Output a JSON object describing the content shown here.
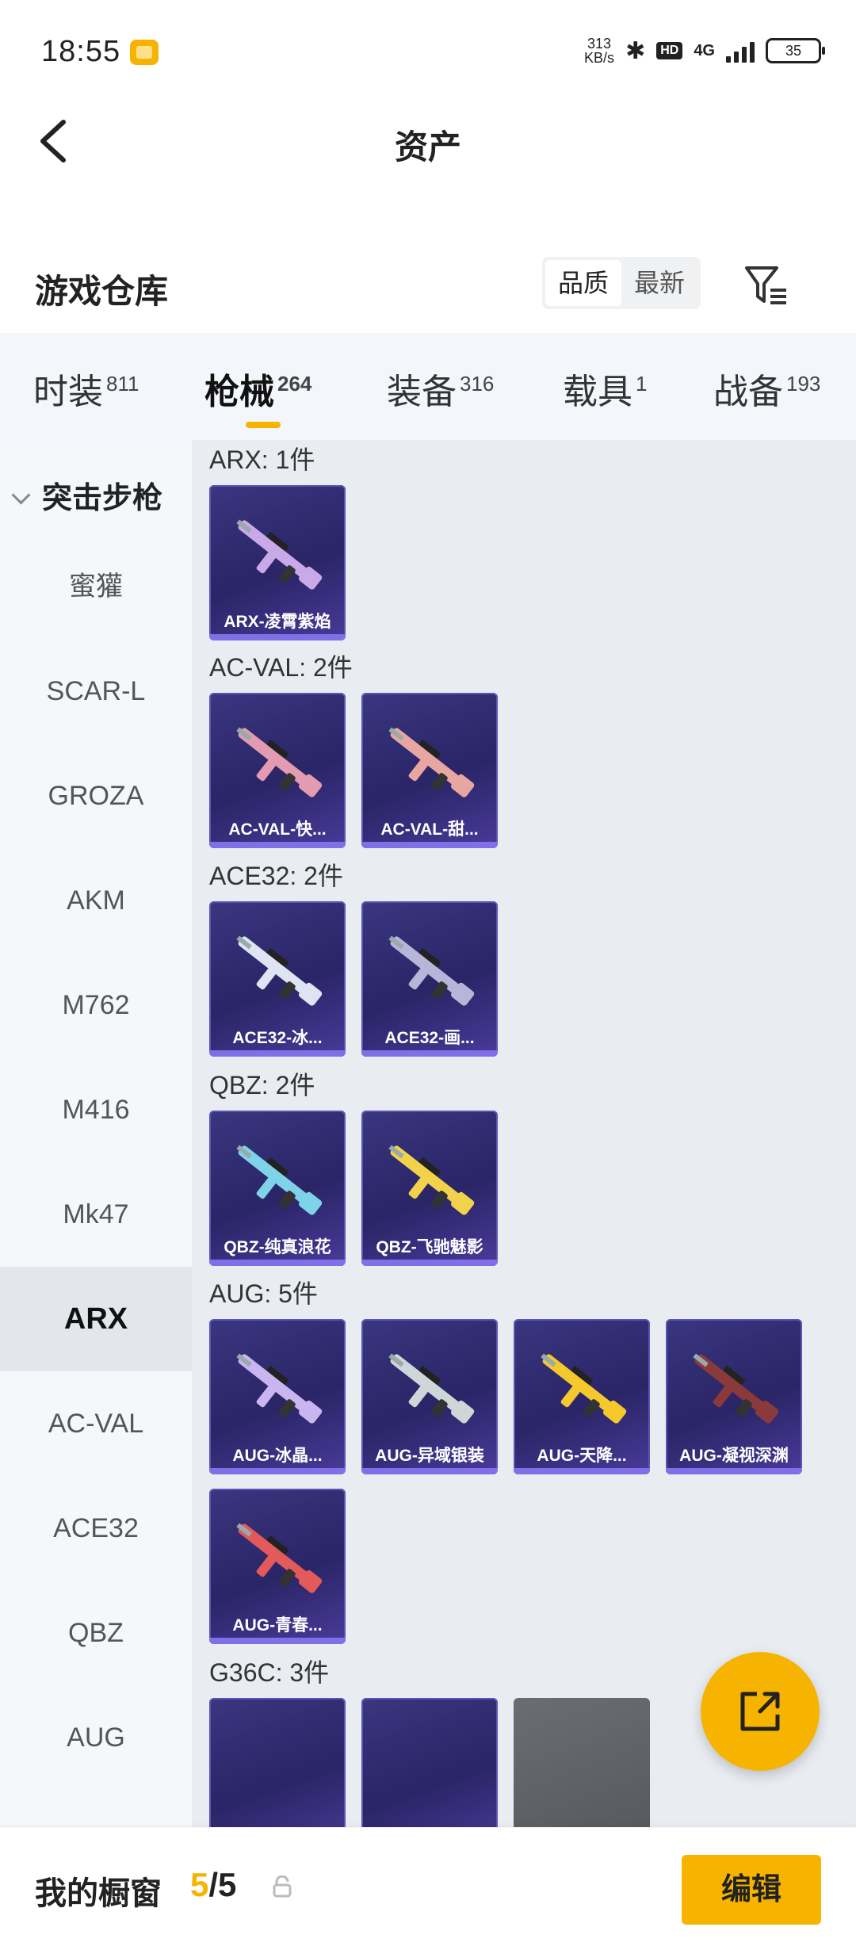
{
  "status_bar": {
    "time": "18:55",
    "net_speed_value": "313",
    "net_speed_unit": "KB/s",
    "network": "4G",
    "hd": "HD",
    "battery": "35"
  },
  "nav": {
    "title": "资产"
  },
  "warehouse": {
    "title": "游戏仓库",
    "sort_options": [
      "品质",
      "最新"
    ],
    "active_sort": "品质"
  },
  "tabs": [
    {
      "label": "时装",
      "count": "811"
    },
    {
      "label": "枪械",
      "count": "264"
    },
    {
      "label": "装备",
      "count": "316"
    },
    {
      "label": "载具",
      "count": "1"
    },
    {
      "label": "战备",
      "count": "193"
    }
  ],
  "active_tab": "枪械",
  "sidebar": {
    "header": "突击步枪",
    "items": [
      "蜜獾",
      "SCAR-L",
      "GROZA",
      "AKM",
      "M762",
      "M416",
      "Mk47",
      "ARX",
      "AC-VAL",
      "ACE32",
      "QBZ",
      "AUG"
    ],
    "active_item": "ARX"
  },
  "groups": [
    {
      "title": "ARX: 1件",
      "items": [
        {
          "name": "ARX-凌霄紫焰",
          "gun_color": "#c9a9e8"
        }
      ]
    },
    {
      "title": "AC-VAL: 2件",
      "items": [
        {
          "name": "AC-VAL-快...",
          "gun_color": "#e29bb0"
        },
        {
          "name": "AC-VAL-甜...",
          "gun_color": "#e8a6a0"
        }
      ]
    },
    {
      "title": "ACE32: 2件",
      "items": [
        {
          "name": "ACE32-冰...",
          "gun_color": "#dfe4f2"
        },
        {
          "name": "ACE32-画...",
          "gun_color": "#b8b6d8"
        }
      ]
    },
    {
      "title": "QBZ: 2件",
      "items": [
        {
          "name": "QBZ-纯真浪花",
          "gun_color": "#7fd3e8"
        },
        {
          "name": "QBZ-飞驰魅影",
          "gun_color": "#f2d24a"
        }
      ]
    },
    {
      "title": "AUG: 5件",
      "items": [
        {
          "name": "AUG-冰晶...",
          "gun_color": "#c9b6f0"
        },
        {
          "name": "AUG-异域银装",
          "gun_color": "#cfd6d8"
        },
        {
          "name": "AUG-天降...",
          "gun_color": "#f5c82e"
        },
        {
          "name": "AUG-凝视深渊",
          "gun_color": "#8a3a3a"
        },
        {
          "name": "AUG-青春...",
          "gun_color": "#e45a5a"
        }
      ]
    },
    {
      "title": "G36C: 3件",
      "items": []
    }
  ],
  "bottom": {
    "label": "我的橱窗",
    "count_used": "5",
    "count_sep": "/",
    "count_total": "5",
    "edit_label": "编辑"
  },
  "colors": {
    "accent": "#f6b400",
    "card_bg": "#2a2566"
  }
}
